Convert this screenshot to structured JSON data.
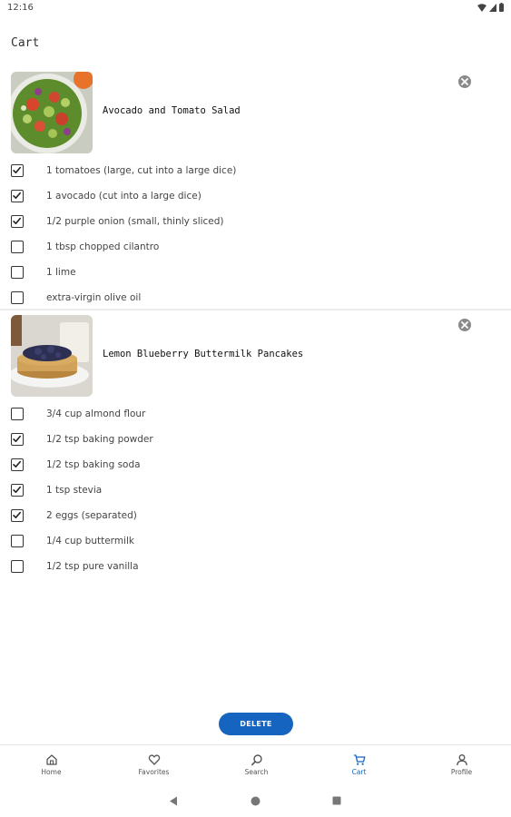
{
  "status": {
    "time": "12:16"
  },
  "page": {
    "title": "Cart"
  },
  "recipes": [
    {
      "title": "Avocado and Tomato Salad",
      "ingredients": [
        {
          "text": "1 tomatoes (large, cut into a large dice)",
          "checked": true
        },
        {
          "text": "1 avocado (cut into a large dice)",
          "checked": true
        },
        {
          "text": "1/2 purple onion (small, thinly sliced)",
          "checked": true
        },
        {
          "text": "1 tbsp chopped cilantro",
          "checked": false
        },
        {
          "text": "1 lime",
          "checked": false
        },
        {
          "text": "extra-virgin olive oil",
          "checked": false
        }
      ]
    },
    {
      "title": "Lemon Blueberry Buttermilk Pancakes",
      "ingredients": [
        {
          "text": "3/4 cup almond flour",
          "checked": false
        },
        {
          "text": "1/2 tsp baking powder",
          "checked": true
        },
        {
          "text": "1/2 tsp baking soda",
          "checked": true
        },
        {
          "text": "1 tsp stevia",
          "checked": true
        },
        {
          "text": "2 eggs (separated)",
          "checked": true
        },
        {
          "text": "1/4 cup buttermilk",
          "checked": false
        },
        {
          "text": "1/2 tsp pure vanilla",
          "checked": false
        }
      ]
    }
  ],
  "actions": {
    "delete_label": "DELETE"
  },
  "nav": {
    "items": [
      {
        "label": "Home",
        "icon": "home-icon"
      },
      {
        "label": "Favorites",
        "icon": "heart-icon"
      },
      {
        "label": "Search",
        "icon": "search-icon"
      },
      {
        "label": "Cart",
        "icon": "cart-icon",
        "active": true
      },
      {
        "label": "Profile",
        "icon": "person-icon"
      }
    ]
  },
  "colors": {
    "accent": "#1565c0",
    "text": "#222222",
    "muted": "#444444"
  }
}
